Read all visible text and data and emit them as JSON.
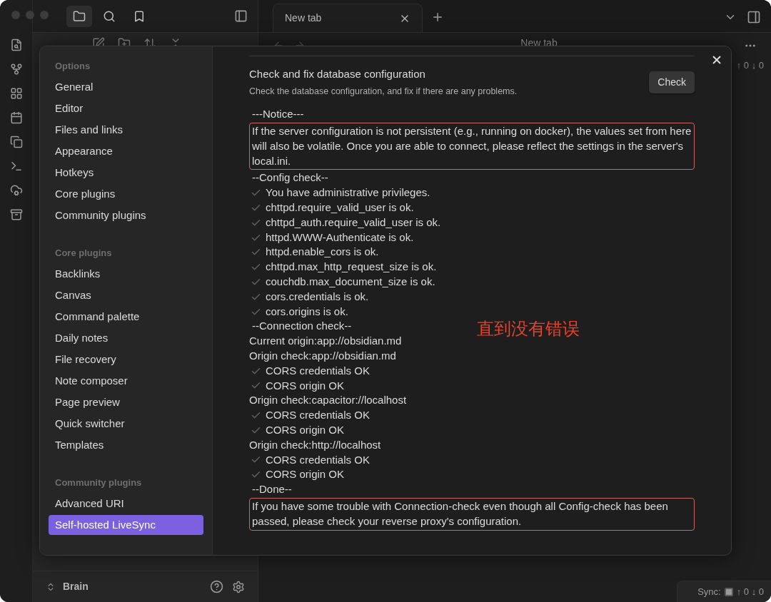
{
  "left_tabs": [
    {
      "selected": true
    },
    {
      "selected": false
    },
    {
      "selected": false
    }
  ],
  "tabs": [
    {
      "label": "New tab",
      "selected": true
    }
  ],
  "view_header": {
    "title": "New tab"
  },
  "side_counts": "↑ 0 ↓ 0",
  "vault": {
    "name": "Brain"
  },
  "status_bar": {
    "label": "Sync:",
    "counts": "↑ 0 ↓ 0"
  },
  "settings": {
    "nav": [
      {
        "heading": "Options",
        "items": [
          {
            "label": "General",
            "selected": false
          },
          {
            "label": "Editor",
            "selected": false
          },
          {
            "label": "Files and links",
            "selected": false
          },
          {
            "label": "Appearance",
            "selected": false
          },
          {
            "label": "Hotkeys",
            "selected": false
          },
          {
            "label": "Core plugins",
            "selected": false
          },
          {
            "label": "Community plugins",
            "selected": false
          }
        ]
      },
      {
        "heading": "Core plugins",
        "items": [
          {
            "label": "Backlinks",
            "selected": false
          },
          {
            "label": "Canvas",
            "selected": false
          },
          {
            "label": "Command palette",
            "selected": false
          },
          {
            "label": "Daily notes",
            "selected": false
          },
          {
            "label": "File recovery",
            "selected": false
          },
          {
            "label": "Note composer",
            "selected": false
          },
          {
            "label": "Page preview",
            "selected": false
          },
          {
            "label": "Quick switcher",
            "selected": false
          },
          {
            "label": "Templates",
            "selected": false
          }
        ]
      },
      {
        "heading": "Community plugins",
        "items": [
          {
            "label": "Advanced URI",
            "selected": false
          },
          {
            "label": "Self-hosted LiveSync",
            "selected": true
          }
        ]
      }
    ],
    "section": {
      "title": "Check and fix database configuration",
      "description": "Check the database configuration, and fix if there are any problems.",
      "button": "Check"
    },
    "log": [
      {
        "kind": "heading",
        "text": "---Notice---"
      },
      {
        "kind": "notice",
        "text": "If the server configuration is not persistent (e.g., running on docker), the values set from here will also be volatile. Once you are able to connect, please reflect the settings in the server's local.ini."
      },
      {
        "kind": "heading",
        "text": "--Config check--"
      },
      {
        "kind": "ok",
        "text": "You have administrative privileges."
      },
      {
        "kind": "ok",
        "text": "chttpd.require_valid_user is ok."
      },
      {
        "kind": "ok",
        "text": "chttpd_auth.require_valid_user is ok."
      },
      {
        "kind": "ok",
        "text": "httpd.WWW-Authenticate is ok."
      },
      {
        "kind": "ok",
        "text": "httpd.enable_cors is ok."
      },
      {
        "kind": "ok",
        "text": "chttpd.max_http_request_size is ok."
      },
      {
        "kind": "ok",
        "text": "couchdb.max_document_size is ok."
      },
      {
        "kind": "ok",
        "text": "cors.credentials is ok."
      },
      {
        "kind": "ok",
        "text": "cors.origins is ok."
      },
      {
        "kind": "heading",
        "text": "--Connection check--"
      },
      {
        "kind": "plain",
        "text": "Current origin:app://obsidian.md"
      },
      {
        "kind": "plain",
        "text": "Origin check:app://obsidian.md"
      },
      {
        "kind": "ok",
        "text": "CORS credentials OK"
      },
      {
        "kind": "ok",
        "text": "CORS origin OK"
      },
      {
        "kind": "plain",
        "text": "Origin check:capacitor://localhost"
      },
      {
        "kind": "ok",
        "text": "CORS credentials OK"
      },
      {
        "kind": "ok",
        "text": "CORS origin OK"
      },
      {
        "kind": "plain",
        "text": "Origin check:http://localhost"
      },
      {
        "kind": "ok",
        "text": "CORS credentials OK"
      },
      {
        "kind": "ok",
        "text": "CORS origin OK"
      },
      {
        "kind": "heading",
        "text": "--Done--"
      },
      {
        "kind": "notice",
        "text": "If you have some trouble with Connection-check even though all Config-check has been passed, please check your reverse proxy's configuration."
      }
    ],
    "annotation": "直到没有错误"
  }
}
